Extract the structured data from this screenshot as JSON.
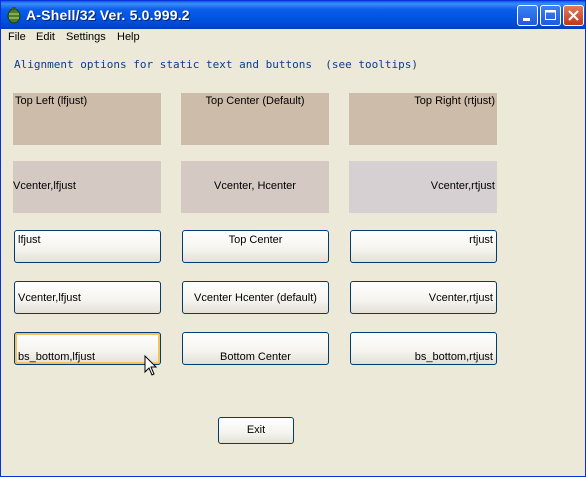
{
  "window": {
    "title": "A-Shell/32 Ver. 5.0.999.2"
  },
  "menu": [
    "File",
    "Edit",
    "Settings",
    "Help"
  ],
  "heading": "Alignment options for static text and buttons  (see tooltips)",
  "static_labels": {
    "row1": [
      "Top Left (lfjust)",
      "Top Center (Default)",
      "Top Right (rtjust)"
    ],
    "row2": [
      "Vcenter,lfjust",
      "Vcenter, Hcenter",
      "Vcenter,rtjust"
    ]
  },
  "buttons": {
    "row1": [
      "lfjust",
      "Top Center",
      "rtjust"
    ],
    "row2": [
      "Vcenter,lfjust",
      "Vcenter Hcenter (default)",
      "Vcenter,rtjust"
    ],
    "row3": [
      "bs_bottom,lfjust",
      "Bottom Center",
      "bs_bottom,rtjust"
    ]
  },
  "exit_label": "Exit",
  "colors": {
    "static_row1": "#cdbca9",
    "static_row2": "#d4c9c3",
    "static_row2_right": "#d6d0d2",
    "heading": "#0b3d91",
    "titlebar": "#0054e3"
  }
}
